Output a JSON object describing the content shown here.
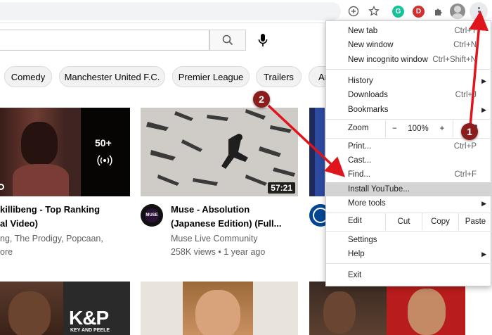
{
  "browser": {
    "toolbar_icons": [
      "add-circle-icon",
      "star-icon",
      "grammarly-icon",
      "dashlane-icon",
      "puzzle-icon",
      "profile-avatar",
      "kebab-menu-icon"
    ],
    "ext_g_letter": "G",
    "ext_d_letter": "D"
  },
  "youtube": {
    "search_placeholder": "",
    "chips": [
      "Comedy",
      "Manchester United F.C.",
      "Premier League",
      "Trailers",
      "An"
    ],
    "videos": [
      {
        "title_lines": [
          "killibeng - Top Ranking",
          "al Video)"
        ],
        "meta_lines": [
          "ng, The Prodigy, Popcaan,",
          "ore"
        ],
        "overlay_count": "50+"
      },
      {
        "title_lines": [
          "Muse - Absolution",
          "(Japanese Edition) (Full..."
        ],
        "channel": "Muse Live Community",
        "stats": "258K views • 1 year ago",
        "duration": "57:21",
        "channel_avatar_text": "MUSE"
      }
    ],
    "kp_text": "K&P",
    "kp_subtext": "KEY AND PEELE"
  },
  "menu": {
    "items": {
      "new_tab": {
        "label": "New tab",
        "shortcut": "Ctrl+T"
      },
      "new_window": {
        "label": "New window",
        "shortcut": "Ctrl+N"
      },
      "new_incognito": {
        "label": "New incognito window",
        "shortcut": "Ctrl+Shift+N"
      },
      "history": {
        "label": "History"
      },
      "downloads": {
        "label": "Downloads",
        "shortcut": "Ctrl+J"
      },
      "bookmarks": {
        "label": "Bookmarks"
      },
      "print": {
        "label": "Print...",
        "shortcut": "Ctrl+P"
      },
      "cast": {
        "label": "Cast..."
      },
      "find": {
        "label": "Find...",
        "shortcut": "Ctrl+F"
      },
      "install": {
        "label": "Install YouTube..."
      },
      "more_tools": {
        "label": "More tools"
      },
      "settings": {
        "label": "Settings"
      },
      "help": {
        "label": "Help"
      },
      "exit": {
        "label": "Exit"
      }
    },
    "zoom": {
      "label": "Zoom",
      "minus": "−",
      "value": "100%",
      "plus": "+"
    },
    "edit": {
      "label": "Edit",
      "cut": "Cut",
      "copy": "Copy",
      "paste": "Paste"
    }
  },
  "annotations": {
    "badge_1": "1",
    "badge_2": "2",
    "arrow_color": "#e0151c",
    "badge_color": "#8b1d1d"
  }
}
